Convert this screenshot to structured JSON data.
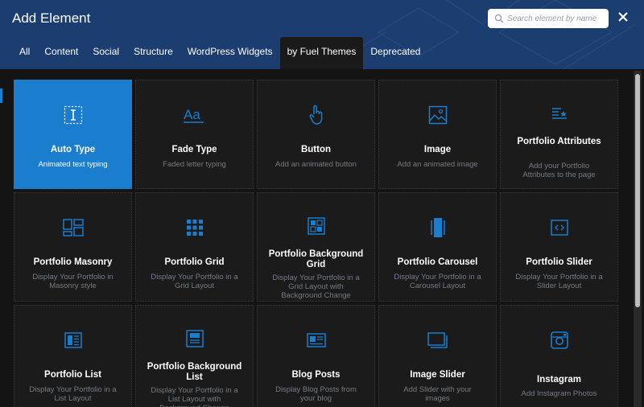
{
  "dialog": {
    "title": "Add Element",
    "search_placeholder": "Search element by name",
    "close_icon": "close-icon"
  },
  "tabs": [
    {
      "label": "All",
      "active": false
    },
    {
      "label": "Content",
      "active": false
    },
    {
      "label": "Social",
      "active": false
    },
    {
      "label": "Structure",
      "active": false
    },
    {
      "label": "WordPress Widgets",
      "active": false
    },
    {
      "label": "by Fuel Themes",
      "active": true
    },
    {
      "label": "Deprecated",
      "active": false
    }
  ],
  "colors": {
    "header": "#1c3d70",
    "accent": "#1a7dce",
    "cell_bg": "#1b1b1b",
    "page_bg": "#141414"
  },
  "elements": [
    {
      "name": "Auto Type",
      "desc": "Animated text typing",
      "icon": "text-cursor-icon",
      "active": true
    },
    {
      "name": "Fade Type",
      "desc": "Faded letter typing",
      "icon": "font-aa-icon"
    },
    {
      "name": "Button",
      "desc": "Add an animated button",
      "icon": "pointer-hand-icon"
    },
    {
      "name": "Image",
      "desc": "Add an animated image",
      "icon": "image-icon"
    },
    {
      "name": "Portfolio Attributes",
      "desc": "Add your Portfolio Attributes to the page",
      "icon": "list-star-icon"
    },
    {
      "name": "Portfolio Masonry",
      "desc": "Display Your Portfolio in Masonry style",
      "icon": "masonry-icon"
    },
    {
      "name": "Portfolio Grid",
      "desc": "Display Your Portfolio in a Grid Layout",
      "icon": "grid-icon"
    },
    {
      "name": "Portfolio Background Grid",
      "desc": "Display Your Portfolio in a Grid Layout with Background Change",
      "icon": "background-grid-icon"
    },
    {
      "name": "Portfolio Carousel",
      "desc": "Display Your Portfolio in a Carousel Layout",
      "icon": "carousel-icon"
    },
    {
      "name": "Portfolio Slider",
      "desc": "Display Your Portfolio in a Slider Layout",
      "icon": "slider-code-icon"
    },
    {
      "name": "Portfolio List",
      "desc": "Display Your Portfolio in a List Layout",
      "icon": "list-layout-icon"
    },
    {
      "name": "Portfolio Background List",
      "desc": "Display Your Portfolio in a List Layout with Background Change",
      "icon": "background-list-icon"
    },
    {
      "name": "Blog Posts",
      "desc": "Display Blog Posts from your blog",
      "icon": "blog-posts-icon"
    },
    {
      "name": "Image Slider",
      "desc": "Add Slider with your images",
      "icon": "image-slider-icon"
    },
    {
      "name": "Instagram",
      "desc": "Add Instagram Photos",
      "icon": "instagram-icon"
    }
  ]
}
